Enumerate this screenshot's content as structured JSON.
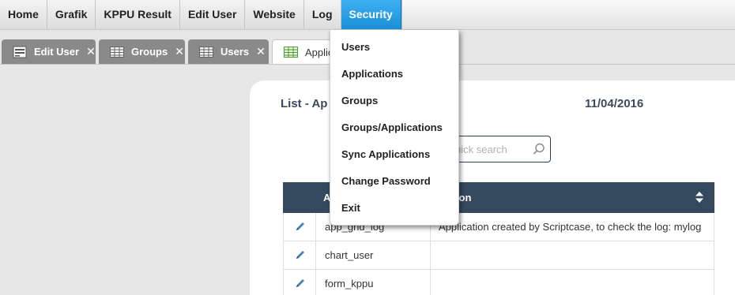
{
  "menubar": {
    "items": [
      {
        "label": "Home"
      },
      {
        "label": "Grafik"
      },
      {
        "label": "KPPU Result"
      },
      {
        "label": "Edit User"
      },
      {
        "label": "Website"
      },
      {
        "label": "Log"
      },
      {
        "label": "Security",
        "active": true
      }
    ]
  },
  "tabs": [
    {
      "label": "Edit User",
      "icon": "form-icon",
      "close": "✕"
    },
    {
      "label": "Groups",
      "icon": "grid-icon",
      "close": "✕"
    },
    {
      "label": "Users",
      "icon": "grid-icon",
      "close": "✕"
    },
    {
      "label": "Applic",
      "icon": "grid-icon",
      "active": true
    }
  ],
  "dropdown": {
    "items": [
      "Users",
      "Applications",
      "Groups",
      "Groups/Applications",
      "Sync Applications",
      "Change Password",
      "Exit"
    ]
  },
  "content": {
    "title": "List - Ap",
    "date": "11/04/2016",
    "search_placeholder": "uick search",
    "table": {
      "headers": [
        "A",
        "ription"
      ],
      "rows": [
        {
          "name": "app_grid_log",
          "description": "Application created by Scriptcase, to check the log: mylog"
        },
        {
          "name": "chart_user",
          "description": ""
        },
        {
          "name": "form_kppu",
          "description": ""
        }
      ]
    }
  },
  "colors": {
    "accent": "#1a8fd8",
    "header_dark": "#34495e",
    "tab_gray": "#8a8a8a"
  }
}
